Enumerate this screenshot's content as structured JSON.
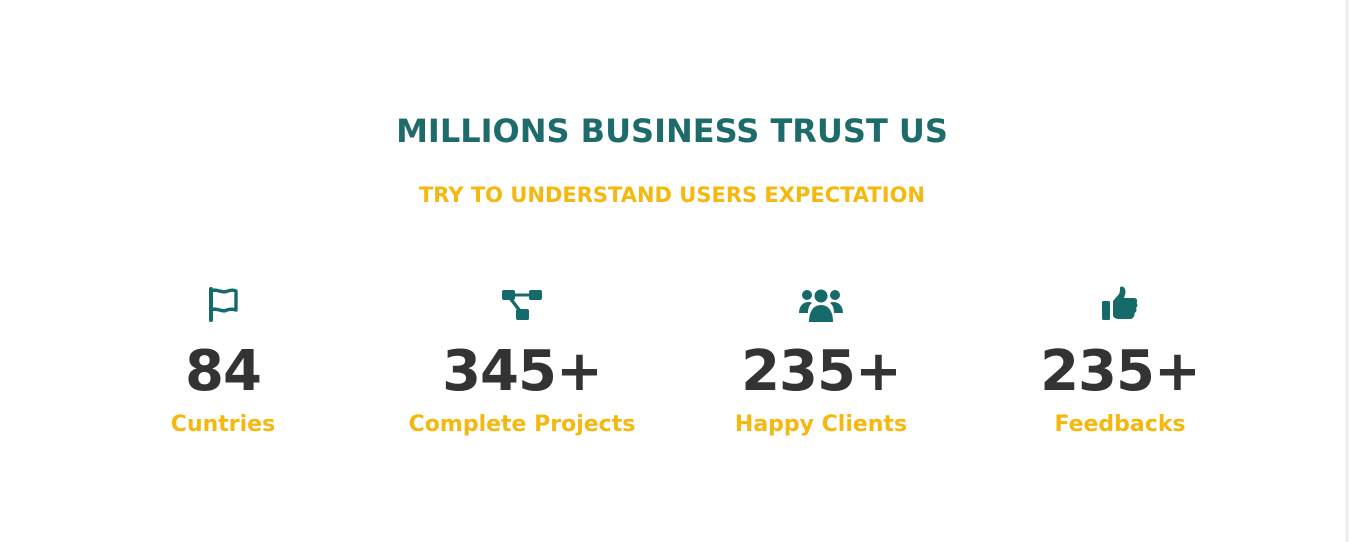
{
  "section": {
    "title": "MILLIONS BUSINESS TRUST US",
    "subtitle": "TRY TO UNDERSTAND USERS EXPECTATION"
  },
  "stats": [
    {
      "icon": "flag-icon",
      "value": "84",
      "label": "Cuntries"
    },
    {
      "icon": "project-diagram-icon",
      "value": "345+",
      "label": "Complete Projects"
    },
    {
      "icon": "users-icon",
      "value": "235+",
      "label": "Happy Clients"
    },
    {
      "icon": "thumbs-up-icon",
      "value": "235+",
      "label": "Feedbacks"
    }
  ],
  "colors": {
    "title": "#1e6b6b",
    "accent": "#f5b80f",
    "number": "#333333",
    "icon": "#176a6a"
  }
}
